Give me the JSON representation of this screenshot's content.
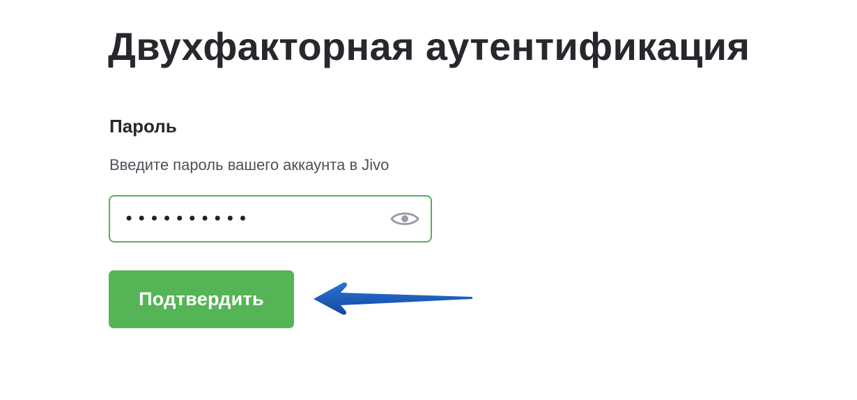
{
  "page": {
    "title": "Двухфакторная аутентификация"
  },
  "password_section": {
    "label": "Пароль",
    "hint": "Введите пароль вашего аккаунта в Jivo",
    "value": "••••••••••",
    "toggle_icon": "eye-icon"
  },
  "actions": {
    "confirm_label": "Подтвердить"
  },
  "colors": {
    "accent_green": "#55b556",
    "input_border": "#5aae5a",
    "arrow_blue": "#1c5fc0",
    "title_text": "#26282d",
    "hint_text": "#4d5058"
  }
}
